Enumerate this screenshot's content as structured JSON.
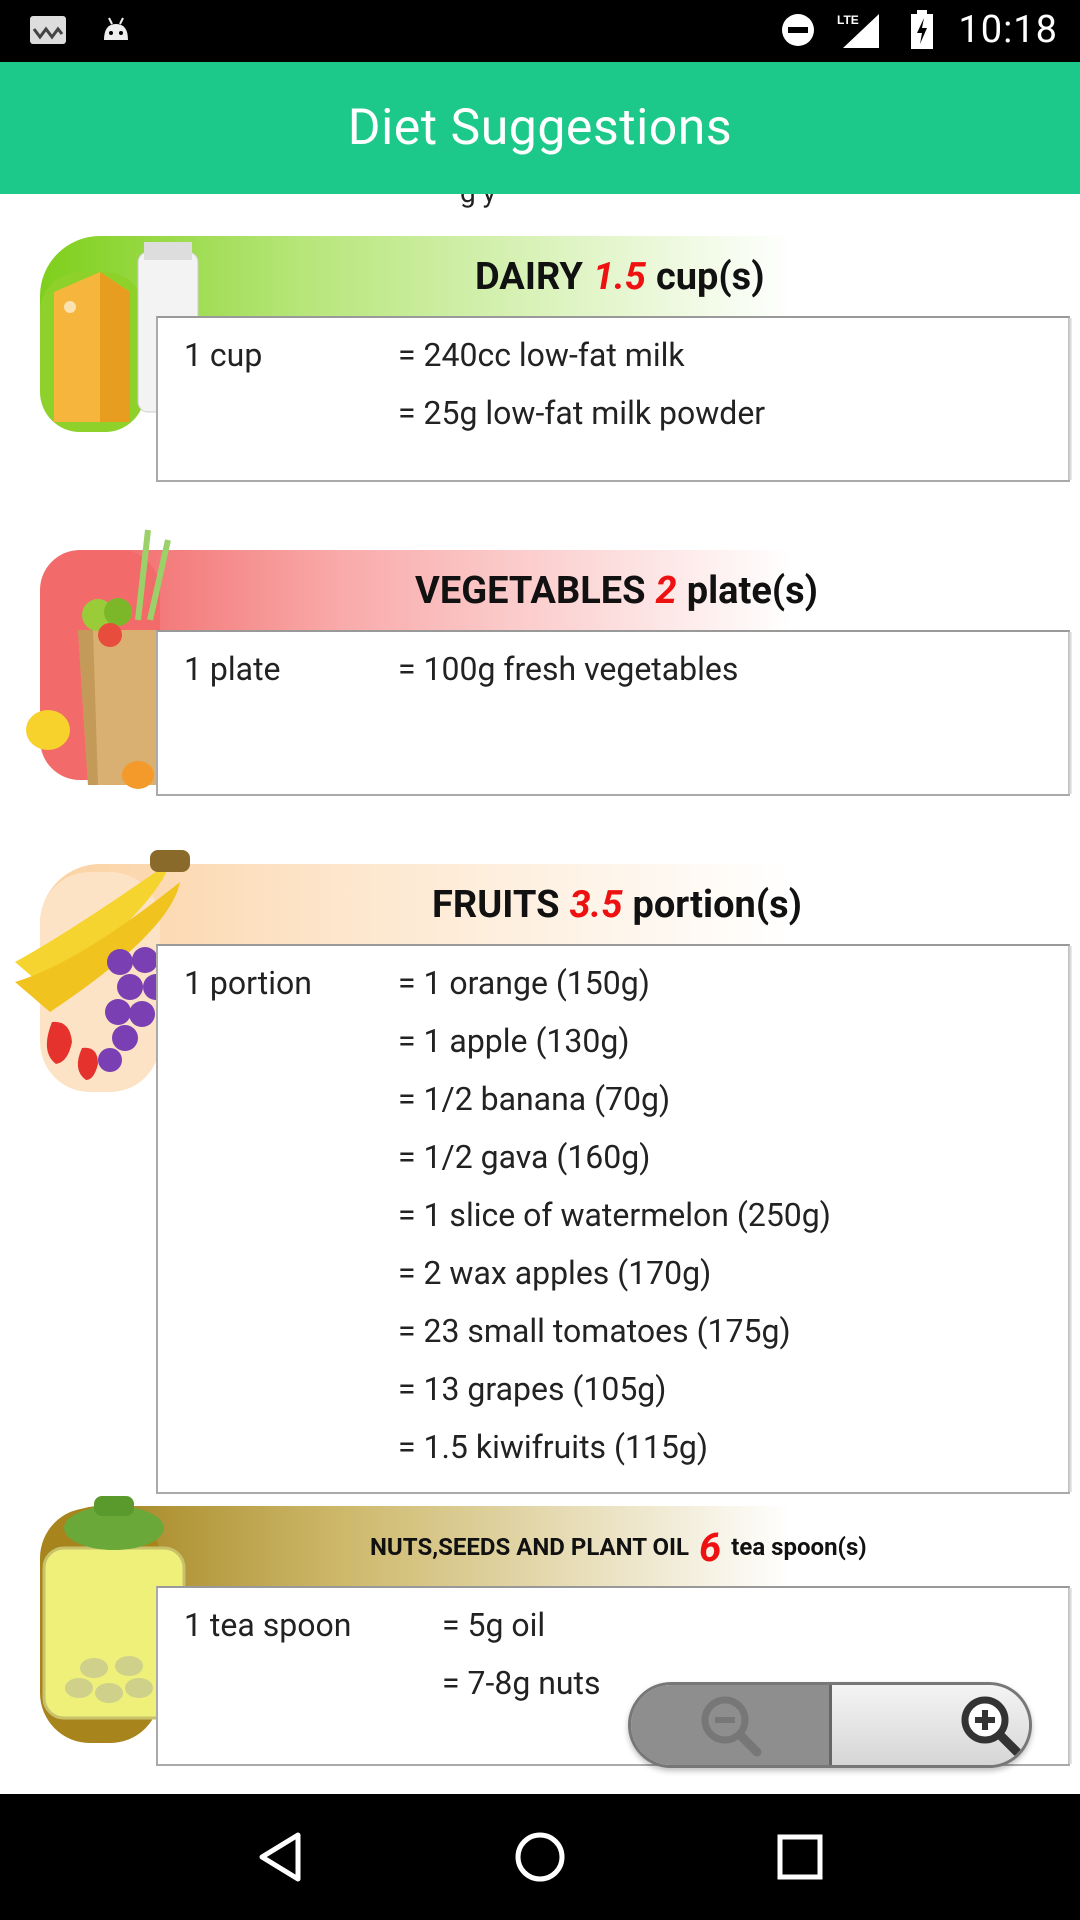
{
  "status_bar": {
    "time": "10:18",
    "network": "LTE"
  },
  "app_bar": {
    "title": "Diet Suggestions"
  },
  "clipped_text": "g y",
  "sections": [
    {
      "name": "DAIRY",
      "amount": "1.5",
      "unit_label": "cup(s)",
      "color": "#8cd63a",
      "rows": [
        {
          "unit": "1 cup",
          "eq": "= 240cc low-fat milk"
        },
        {
          "unit": "",
          "eq": "= 25g low-fat milk powder"
        }
      ]
    },
    {
      "name": "VEGETABLES",
      "amount": "2",
      "unit_label": "plate(s)",
      "color": "#f36a6a",
      "rows": [
        {
          "unit": "1 plate",
          "eq": "= 100g fresh vegetables"
        }
      ]
    },
    {
      "name": "FRUITS",
      "amount": "3.5",
      "unit_label": "portion(s)",
      "color": "#fbd3a8",
      "rows": [
        {
          "unit": "1 portion",
          "eq": "= 1 orange (150g)"
        },
        {
          "unit": "",
          "eq": "= 1 apple (130g)"
        },
        {
          "unit": "",
          "eq": "= 1/2 banana (70g)"
        },
        {
          "unit": "",
          "eq": "= 1/2 gava (160g)"
        },
        {
          "unit": "",
          "eq": "= 1 slice of watermelon (250g)"
        },
        {
          "unit": "",
          "eq": "= 2 wax apples (170g)"
        },
        {
          "unit": "",
          "eq": "= 23 small tomatoes (175g)"
        },
        {
          "unit": "",
          "eq": "= 13 grapes (105g)"
        },
        {
          "unit": "",
          "eq": "= 1.5 kiwifruits (115g)"
        }
      ]
    },
    {
      "name": "NUTS,SEEDS AND PLANT OIL",
      "amount": "6",
      "unit_label": "tea spoon(s)",
      "color": "#a8841c",
      "rows": [
        {
          "unit": "1 tea spoon",
          "eq": "= 5g oil"
        },
        {
          "unit": "",
          "eq": "= 7-8g nuts"
        }
      ]
    }
  ],
  "zoom": {
    "out_icon": "zoom-out-icon",
    "in_icon": "zoom-in-icon"
  },
  "nav": {
    "back": "back-icon",
    "home": "home-icon",
    "recents": "recents-icon"
  }
}
